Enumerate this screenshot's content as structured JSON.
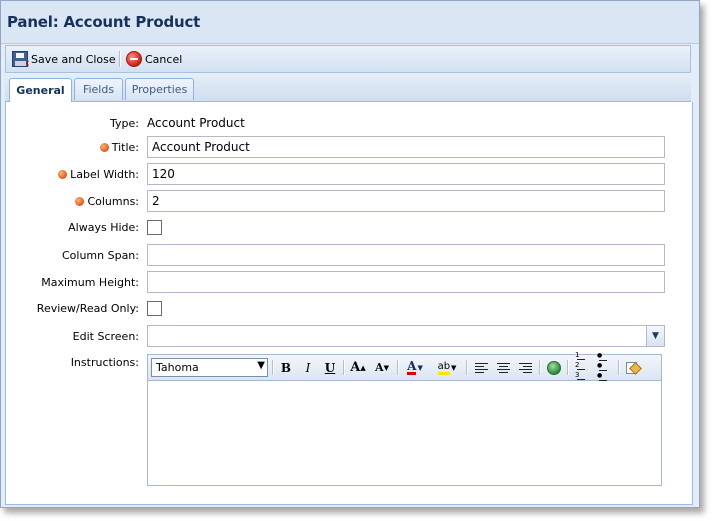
{
  "window": {
    "title": "Panel: Account Product"
  },
  "toolbar": {
    "save_close_label": "Save and Close",
    "cancel_label": "Cancel"
  },
  "tabs": [
    {
      "label": "General",
      "active": true
    },
    {
      "label": "Fields",
      "active": false
    },
    {
      "label": "Properties",
      "active": false
    }
  ],
  "form": {
    "type_label": "Type:",
    "type_value": "Account Product",
    "title_label": "Title:",
    "title_value": "Account Product",
    "label_width_label": "Label Width:",
    "label_width_value": "120",
    "columns_label": "Columns:",
    "columns_value": "2",
    "always_hide_label": "Always Hide:",
    "always_hide_checked": false,
    "column_span_label": "Column Span:",
    "column_span_value": "",
    "max_height_label": "Maximum Height:",
    "max_height_value": "",
    "review_read_only_label": "Review/Read Only:",
    "review_read_only_checked": false,
    "edit_screen_label": "Edit Screen:",
    "edit_screen_value": "",
    "instructions_label": "Instructions:"
  },
  "editor": {
    "font": "Tahoma",
    "bold": "B",
    "italic": "I",
    "underline": "U",
    "grow_font": "A",
    "shrink_font": "A",
    "font_color": "A",
    "highlight": "ab",
    "content": ""
  },
  "colors": {
    "required_marker": "#e0520e",
    "tab_border": "#8db2e3",
    "window_bg": "#e3ecf7",
    "title_text": "#15325a"
  }
}
